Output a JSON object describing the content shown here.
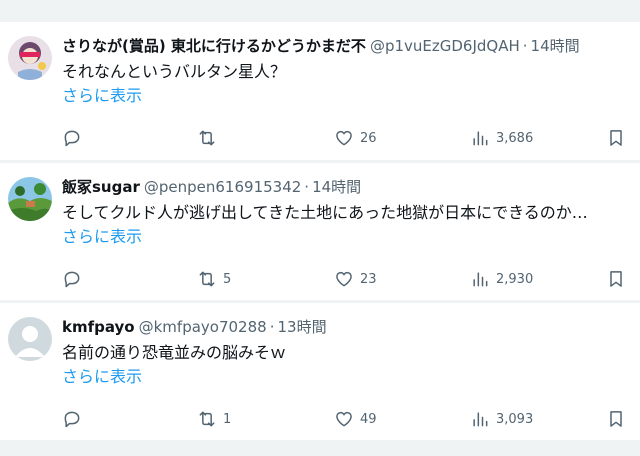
{
  "colors": {
    "link": "#1d9bf0",
    "text": "#0f1419",
    "secondary": "#536471",
    "separator": "#eff3f4"
  },
  "posts": [
    {
      "name": "さりなが(賞品) 東北に行けるかどうかまだ不",
      "handle": "@p1vuEzGD6JdQAH",
      "time": "14時間",
      "text": "それなんというバルタン星人？",
      "more": "さらに表示",
      "replies": "",
      "reposts": "",
      "likes": "26",
      "views": "3,686",
      "avatar_icon": "anime-character-avatar"
    },
    {
      "name": "飯冢sugar",
      "handle": "@penpen616915342",
      "time": "14時間",
      "text": "そしてクルド人が逃げ出してきた土地にあった地獄が日本にできるのか…",
      "more": "さらに表示",
      "replies": "",
      "reposts": "5",
      "likes": "23",
      "views": "2,930",
      "avatar_icon": "landscape-avatar"
    },
    {
      "name": "kmfpayo",
      "handle": "@kmfpayo70288",
      "time": "13時間",
      "text": "名前の通り恐竜並みの脳みそｗ",
      "more": "さらに表示",
      "replies": "",
      "reposts": "1",
      "likes": "49",
      "views": "3,093",
      "avatar_icon": "default-person-avatar"
    }
  ]
}
